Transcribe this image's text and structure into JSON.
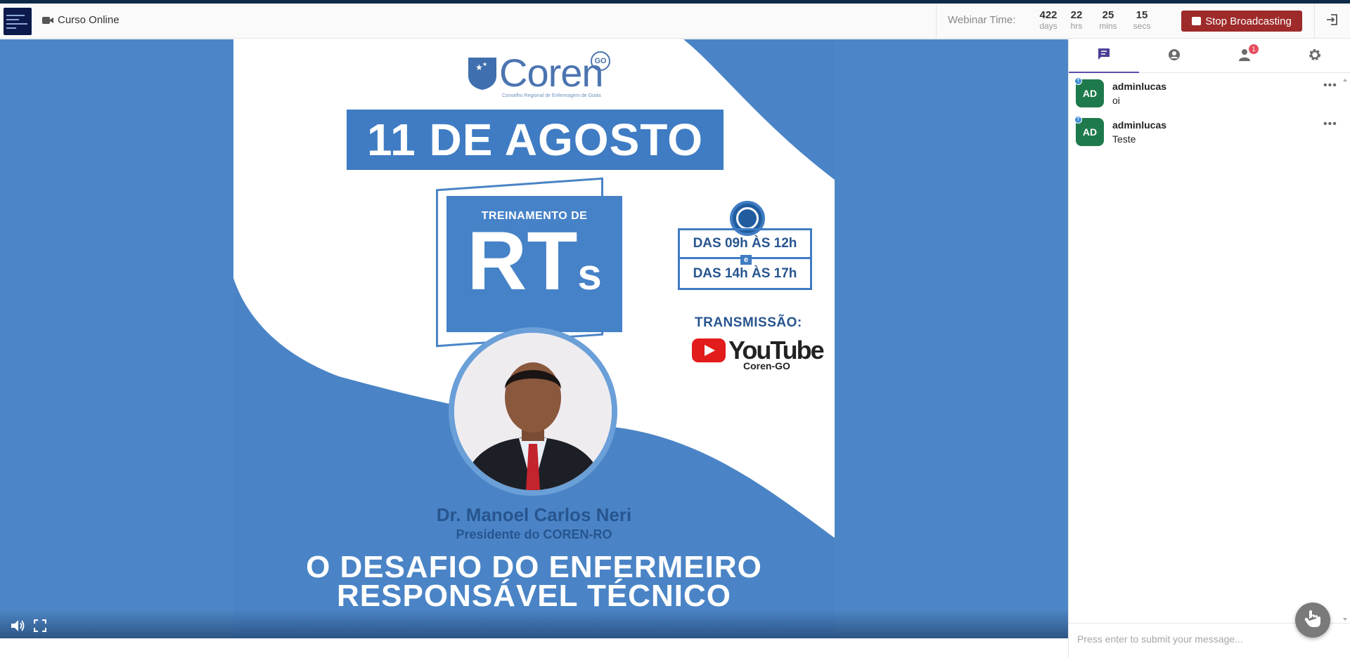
{
  "header": {
    "title": "Curso Online",
    "webinar_time_label": "Webinar Time:",
    "timer": [
      {
        "value": "422",
        "unit": "days"
      },
      {
        "value": "22",
        "unit": "hrs"
      },
      {
        "value": "25",
        "unit": "mins"
      },
      {
        "value": "15",
        "unit": "secs"
      }
    ],
    "stop_label": "Stop Broadcasting",
    "icons": {
      "title": "video-camera-icon",
      "exit": "exit-icon"
    }
  },
  "poster": {
    "logo_text": "Coren",
    "logo_badge": "GO",
    "logo_subtitle": "Conselho Regional de Enfermagem de Goiás",
    "date": "11 DE AGOSTO",
    "training_label": "TREINAMENTO DE",
    "rts_main": "RT",
    "rts_suffix": "s",
    "schedule_1": "DAS 09h ÀS 12h",
    "schedule_and": "e",
    "schedule_2": "DAS 14h ÀS 17h",
    "transmission": "TRANSMISSÃO:",
    "youtube": "YouTube",
    "youtube_channel": "Coren-GO",
    "speaker_name": "Dr. Manoel Carlos Neri",
    "speaker_role": "Presidente do COREN-RO",
    "headline_1": "O DESAFIO DO ENFERMEIRO",
    "headline_2": "RESPONSÁVEL TÉCNICO"
  },
  "video_controls": {
    "icons": [
      "volume-icon",
      "fullscreen-icon"
    ]
  },
  "sidebar": {
    "tabs": [
      {
        "name": "chat",
        "icon": "chat-icon"
      },
      {
        "name": "profile",
        "icon": "profile-icon"
      },
      {
        "name": "attendees",
        "icon": "attendees-icon",
        "badge": "1"
      },
      {
        "name": "settings",
        "icon": "gear-icon"
      }
    ],
    "messages": [
      {
        "avatar": "AD",
        "role_badge": "T",
        "user": "adminlucas",
        "text": "oi"
      },
      {
        "avatar": "AD",
        "role_badge": "T",
        "user": "adminlucas",
        "text": "Teste"
      }
    ],
    "more_glyph": "•••",
    "input_placeholder": "Press enter to submit your message..."
  },
  "colors": {
    "accent": "#5b4fa8",
    "stop": "#9e2a2a",
    "avatar": "#1e7a4c",
    "video_bg": "#4d86c6",
    "topline": "#0e2a47"
  }
}
